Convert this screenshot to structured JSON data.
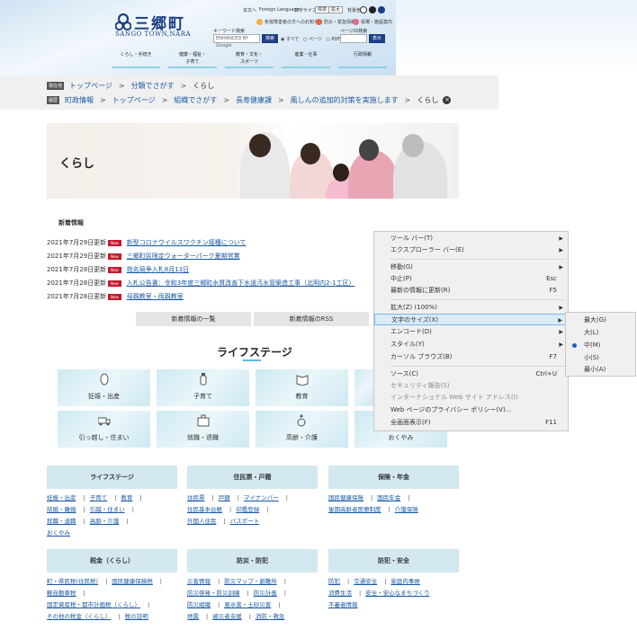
{
  "header": {
    "logo_name": "三郷町",
    "logo_sub": "SANGO TOWN,NARA",
    "util": {
      "home": "本文へ",
      "foreign": "Foreign Language",
      "fontsize": "文字サイズ",
      "standard": "標準",
      "large": "拡大",
      "bgcolor": "背景色",
      "dyslexia": "色覚障害者の方へのお知らせ",
      "disaster": "防災・緊急情報",
      "office": "役場・施設案内"
    },
    "keyword_label": "キーワード検索",
    "keyword_placeholder": "ENHANCED BY Google",
    "search_button": "検索",
    "radio_all": "すべて",
    "radio_page": "ページ",
    "radio_pdf": "PDF",
    "pageid_label": "ページID検索",
    "pageid_button": "表示",
    "nav": [
      {
        "label1": "くらし・手続き",
        "label2": ""
      },
      {
        "label1": "健康・福祉・",
        "label2": "子育て"
      },
      {
        "label1": "教育・文化・",
        "label2": "スポーツ"
      },
      {
        "label1": "産業・仕事",
        "label2": ""
      },
      {
        "label1": "行政情報",
        "label2": ""
      }
    ]
  },
  "breadcrumb1": {
    "tag": "現在地",
    "items": [
      "トップページ",
      "分類でさがす",
      "くらし"
    ]
  },
  "breadcrumb2": {
    "tag": "履歴",
    "items": [
      "町政情報",
      "トップページ",
      "組織でさがす",
      "長寿健康課",
      "風しんの追加的対策を実施します",
      "くらし"
    ]
  },
  "hero": {
    "title": "くらし"
  },
  "news": {
    "title": "新着情報",
    "new_badge": "New",
    "items": [
      {
        "date": "2021年7月29日更新",
        "text": "新型コロナウイルスワクチン接種について"
      },
      {
        "date": "2021年7月29日更新",
        "text": "三郷町民限定ウォーターパーク夏期営業"
      },
      {
        "date": "2021年7月28日更新",
        "text": "指名競争入札8月13日"
      },
      {
        "date": "2021年7月28日更新",
        "text": "入札公告書：令和3年度三郷町水質改善下水道汚水管築造工事（北明内2-1工区）"
      },
      {
        "date": "2021年7月28日更新",
        "text": "母親教室・両親教室"
      }
    ],
    "list_button": "新着情報の一覧",
    "rss_button": "新着情報のRSS"
  },
  "lifestage": {
    "title": "ライフステージ",
    "tiles": [
      "妊娠・出産",
      "子育て",
      "教育",
      "引っ越し・住まい",
      "就職・退職",
      "高齢・介護",
      "おくやみ"
    ]
  },
  "categories": [
    {
      "title": "ライフステージ",
      "links": [
        "妊娠・出産",
        "子育て",
        "教育",
        "結婚・離婚",
        "引越・住まい",
        "就職・退職",
        "高齢・介護",
        "おくやみ"
      ]
    },
    {
      "title": "住民票・戸籍",
      "links": [
        "住民票",
        "戸籍",
        "マイナンバー",
        "住民基本台帳",
        "印鑑登録",
        "外国人住民",
        "パスポート"
      ]
    },
    {
      "title": "保険・年金",
      "links": [
        "国民健康保険",
        "国民年金",
        "後期高齢者医療制度",
        "介護保険"
      ]
    },
    {
      "title": "税金（くらし）",
      "links": [
        "町・県民税(住民税)",
        "国民健康保険税",
        "軽自動車税",
        "固定資産税・都市計画税（くらし）",
        "その他の税金（くらし）",
        "税の証明"
      ]
    },
    {
      "title": "防災・防犯",
      "links": [
        "災害情報",
        "防災マップ・避難所",
        "防災啓発・防災訓練",
        "防災計画",
        "防災組織",
        "風水害・土砂災害",
        "地震",
        "被災者支援",
        "消防・救急"
      ]
    },
    {
      "title": "防犯・安全",
      "links": [
        "防犯",
        "交通安全",
        "家庭内事故",
        "消費生活",
        "安全・安心なまちづくり",
        "不審者情報"
      ]
    }
  ],
  "context_menu": {
    "items": [
      {
        "label": "ツール バー(T)",
        "shortcut": "",
        "arrow": "▶"
      },
      {
        "label": "エクスプローラー バー(E)",
        "shortcut": "",
        "arrow": "▶"
      },
      {
        "label": "移動(G)",
        "shortcut": "",
        "arrow": "▶"
      },
      {
        "label": "中止(P)",
        "shortcut": "Esc",
        "arrow": ""
      },
      {
        "label": "最新の情報に更新(R)",
        "shortcut": "F5",
        "arrow": ""
      },
      {
        "label": "拡大(Z) (100%)",
        "shortcut": "",
        "arrow": "▶"
      },
      {
        "label": "文字のサイズ(X)",
        "shortcut": "",
        "arrow": "▶"
      },
      {
        "label": "エンコード(D)",
        "shortcut": "",
        "arrow": "▶"
      },
      {
        "label": "スタイル(Y)",
        "shortcut": "",
        "arrow": "▶"
      },
      {
        "label": "カーソル ブラウズ(B)",
        "shortcut": "F7",
        "arrow": ""
      },
      {
        "label": "ソース(C)",
        "shortcut": "Ctrl+U",
        "arrow": ""
      },
      {
        "label": "セキュリティ報告(S)",
        "shortcut": "",
        "arrow": ""
      },
      {
        "label": "インターナショナル Web サイト アドレス(I)",
        "shortcut": "",
        "arrow": ""
      },
      {
        "label": "Web ページのプライバシー ポリシー(V)...",
        "shortcut": "",
        "arrow": ""
      },
      {
        "label": "全画面表示(F)",
        "shortcut": "F11",
        "arrow": ""
      }
    ]
  },
  "text_size_menu": {
    "items": [
      "最大(G)",
      "大(L)",
      "中(M)",
      "小(S)",
      "最小(A)"
    ],
    "selected": "中(M)"
  }
}
